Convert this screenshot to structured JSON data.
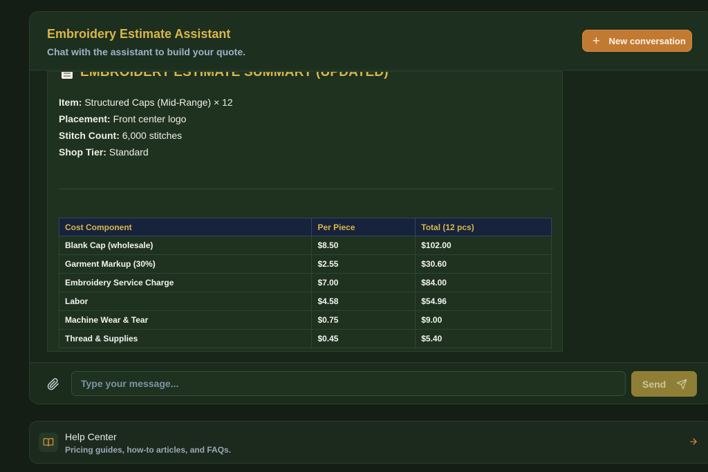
{
  "header": {
    "title": "Embroidery Estimate Assistant",
    "subtitle": "Chat with the assistant to build your quote.",
    "new_conversation_label": "New conversation"
  },
  "message": {
    "heading": "EMBROIDERY ESTIMATE SUMMARY (UPDATED)",
    "details": [
      {
        "key": "Item:",
        "value": "Structured Caps (Mid-Range) × 12"
      },
      {
        "key": "Placement:",
        "value": "Front center logo"
      },
      {
        "key": "Stitch Count:",
        "value": "6,000 stitches"
      },
      {
        "key": "Shop Tier:",
        "value": "Standard"
      }
    ],
    "table": {
      "headers": [
        "Cost Component",
        "Per Piece",
        "Total (12 pcs)"
      ],
      "rows": [
        [
          "Blank Cap (wholesale)",
          "$8.50",
          "$102.00"
        ],
        [
          "Garment Markup (30%)",
          "$2.55",
          "$30.60"
        ],
        [
          "Embroidery Service Charge",
          "$7.00",
          "$84.00"
        ],
        [
          "Labor",
          "$4.58",
          "$54.96"
        ],
        [
          "Machine Wear & Tear",
          "$0.75",
          "$9.00"
        ],
        [
          "Thread & Supplies",
          "$0.45",
          "$5.40"
        ]
      ]
    }
  },
  "composer": {
    "placeholder": "Type your message...",
    "send_label": "Send"
  },
  "help": {
    "title": "Help Center",
    "subtitle": "Pricing guides, how-to articles, and FAQs."
  },
  "colors": {
    "accent_gold": "#d9b64a",
    "button_orange": "#c27a33",
    "send_button": "#8f7f36",
    "background": "#141e15"
  }
}
